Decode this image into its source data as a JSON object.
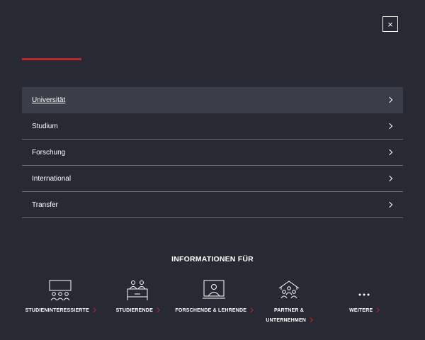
{
  "header": {
    "close_label": "×"
  },
  "nav": {
    "items": [
      {
        "label": "Universität"
      },
      {
        "label": "Studium"
      },
      {
        "label": "Forschung"
      },
      {
        "label": "International"
      },
      {
        "label": "Transfer"
      }
    ]
  },
  "info": {
    "heading": "INFORMATIONEN FÜR",
    "audiences": [
      {
        "label": "STUDIENINTERESSIERTE",
        "icon": "prospective-students-icon"
      },
      {
        "label": "STUDIERENDE",
        "icon": "students-icon"
      },
      {
        "label": "FORSCHENDE & LEHRENDE",
        "icon": "researchers-icon"
      },
      {
        "label_line1": "PARTNER &",
        "label_line2": "UNTERNEHMEN",
        "icon": "partners-icon"
      },
      {
        "label": "WEITERE",
        "icon": "more-icon"
      }
    ]
  },
  "colors": {
    "background": "#272a32",
    "active_item": "#3a3e48",
    "accent": "#c0272d",
    "divider": "#6d717a"
  }
}
